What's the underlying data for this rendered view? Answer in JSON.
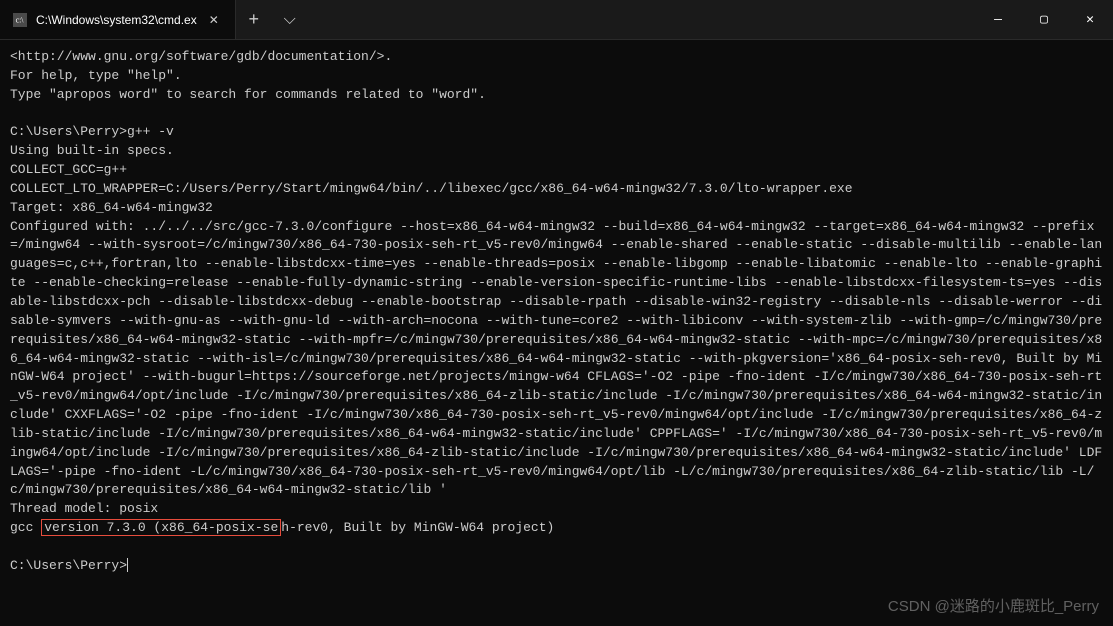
{
  "titlebar": {
    "tab": {
      "icon_name": "cmd-icon",
      "title": "C:\\Windows\\system32\\cmd.ex"
    },
    "newtab_label": "+",
    "dropdown_label": "⌵",
    "minimize_label": "—",
    "maximize_label": "▢",
    "close_label": "✕"
  },
  "terminal": {
    "lines": [
      "<http://www.gnu.org/software/gdb/documentation/>.",
      "For help, type \"help\".",
      "Type \"apropos word\" to search for commands related to \"word\".",
      "",
      "C:\\Users\\Perry>g++ -v",
      "Using built-in specs.",
      "COLLECT_GCC=g++",
      "COLLECT_LTO_WRAPPER=C:/Users/Perry/Start/mingw64/bin/../libexec/gcc/x86_64-w64-mingw32/7.3.0/lto-wrapper.exe",
      "Target: x86_64-w64-mingw32",
      "Configured with: ../../../src/gcc-7.3.0/configure --host=x86_64-w64-mingw32 --build=x86_64-w64-mingw32 --target=x86_64-w64-mingw32 --prefix=/mingw64 --with-sysroot=/c/mingw730/x86_64-730-posix-seh-rt_v5-rev0/mingw64 --enable-shared --enable-static --disable-multilib --enable-languages=c,c++,fortran,lto --enable-libstdcxx-time=yes --enable-threads=posix --enable-libgomp --enable-libatomic --enable-lto --enable-graphite --enable-checking=release --enable-fully-dynamic-string --enable-version-specific-runtime-libs --enable-libstdcxx-filesystem-ts=yes --disable-libstdcxx-pch --disable-libstdcxx-debug --enable-bootstrap --disable-rpath --disable-win32-registry --disable-nls --disable-werror --disable-symvers --with-gnu-as --with-gnu-ld --with-arch=nocona --with-tune=core2 --with-libiconv --with-system-zlib --with-gmp=/c/mingw730/prerequisites/x86_64-w64-mingw32-static --with-mpfr=/c/mingw730/prerequisites/x86_64-w64-mingw32-static --with-mpc=/c/mingw730/prerequisites/x86_64-w64-mingw32-static --with-isl=/c/mingw730/prerequisites/x86_64-w64-mingw32-static --with-pkgversion='x86_64-posix-seh-rev0, Built by MinGW-W64 project' --with-bugurl=https://sourceforge.net/projects/mingw-w64 CFLAGS='-O2 -pipe -fno-ident -I/c/mingw730/x86_64-730-posix-seh-rt_v5-rev0/mingw64/opt/include -I/c/mingw730/prerequisites/x86_64-zlib-static/include -I/c/mingw730/prerequisites/x86_64-w64-mingw32-static/include' CXXFLAGS='-O2 -pipe -fno-ident -I/c/mingw730/x86_64-730-posix-seh-rt_v5-rev0/mingw64/opt/include -I/c/mingw730/prerequisites/x86_64-zlib-static/include -I/c/mingw730/prerequisites/x86_64-w64-mingw32-static/include' CPPFLAGS=' -I/c/mingw730/x86_64-730-posix-seh-rt_v5-rev0/mingw64/opt/include -I/c/mingw730/prerequisites/x86_64-zlib-static/include -I/c/mingw730/prerequisites/x86_64-w64-mingw32-static/include' LDFLAGS='-pipe -fno-ident -L/c/mingw730/x86_64-730-posix-seh-rt_v5-rev0/mingw64/opt/lib -L/c/mingw730/prerequisites/x86_64-zlib-static/lib -L/c/mingw730/prerequisites/x86_64-w64-mingw32-static/lib '",
      "Thread model: posix"
    ],
    "highlight_line_prefix": "gcc ",
    "highlight_text": "version 7.3.0 (x86_64-posix-se",
    "highlight_line_suffix": "h-rev0, Built by MinGW-W64 project)",
    "prompt": "C:\\Users\\Perry>"
  },
  "watermark": "CSDN @迷路的小鹿斑比_Perry"
}
